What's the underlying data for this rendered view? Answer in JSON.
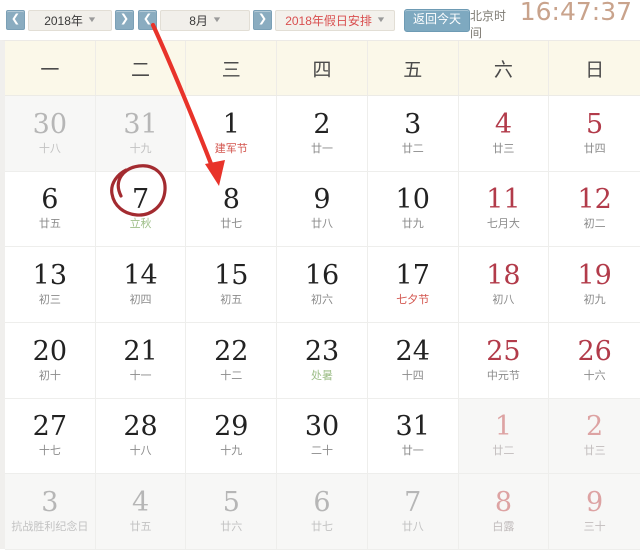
{
  "toolbar": {
    "prev_year_icon": "chevron-left-icon",
    "next_year_icon": "chevron-right-icon",
    "prev_month_icon": "chevron-left-icon",
    "next_month_icon": "chevron-right-icon",
    "year_value": "2018年",
    "month_value": "8月",
    "holiday_value": "2018年假日安排",
    "today_label": "返回今天",
    "caret_icon": "chevron-down-icon",
    "clock_label": "北京时间",
    "clock_time": "16:47:37",
    "accent_blue": "#7ea9c0",
    "holiday_red": "#d94f4f",
    "clock_color": "#c9a38c"
  },
  "calendar": {
    "weekdays": [
      "一",
      "二",
      "三",
      "四",
      "五",
      "六",
      "日"
    ],
    "header_background": "#fbf8e9",
    "weekend_color": "#b23b4a",
    "festival_color": "#d3564f",
    "solar_term_color": "#9fbf8a",
    "days": [
      {
        "num": "30",
        "sub": "十八",
        "out": true,
        "weekend": false,
        "sub_type": "lunar"
      },
      {
        "num": "31",
        "sub": "十九",
        "out": true,
        "weekend": false,
        "sub_type": "lunar"
      },
      {
        "num": "1",
        "sub": "建军节",
        "out": false,
        "weekend": false,
        "sub_type": "festival"
      },
      {
        "num": "2",
        "sub": "廿一",
        "out": false,
        "weekend": false,
        "sub_type": "lunar"
      },
      {
        "num": "3",
        "sub": "廿二",
        "out": false,
        "weekend": false,
        "sub_type": "lunar"
      },
      {
        "num": "4",
        "sub": "廿三",
        "out": false,
        "weekend": true,
        "sub_type": "lunar"
      },
      {
        "num": "5",
        "sub": "廿四",
        "out": false,
        "weekend": true,
        "sub_type": "lunar"
      },
      {
        "num": "6",
        "sub": "廿五",
        "out": false,
        "weekend": false,
        "sub_type": "lunar"
      },
      {
        "num": "7",
        "sub": "立秋",
        "out": false,
        "weekend": false,
        "sub_type": "term"
      },
      {
        "num": "8",
        "sub": "廿七",
        "out": false,
        "weekend": false,
        "sub_type": "lunar"
      },
      {
        "num": "9",
        "sub": "廿八",
        "out": false,
        "weekend": false,
        "sub_type": "lunar"
      },
      {
        "num": "10",
        "sub": "廿九",
        "out": false,
        "weekend": false,
        "sub_type": "lunar"
      },
      {
        "num": "11",
        "sub": "七月大",
        "out": false,
        "weekend": true,
        "sub_type": "lunar"
      },
      {
        "num": "12",
        "sub": "初二",
        "out": false,
        "weekend": true,
        "sub_type": "lunar"
      },
      {
        "num": "13",
        "sub": "初三",
        "out": false,
        "weekend": false,
        "sub_type": "lunar"
      },
      {
        "num": "14",
        "sub": "初四",
        "out": false,
        "weekend": false,
        "sub_type": "lunar"
      },
      {
        "num": "15",
        "sub": "初五",
        "out": false,
        "weekend": false,
        "sub_type": "lunar"
      },
      {
        "num": "16",
        "sub": "初六",
        "out": false,
        "weekend": false,
        "sub_type": "lunar"
      },
      {
        "num": "17",
        "sub": "七夕节",
        "out": false,
        "weekend": false,
        "sub_type": "festival"
      },
      {
        "num": "18",
        "sub": "初八",
        "out": false,
        "weekend": true,
        "sub_type": "lunar"
      },
      {
        "num": "19",
        "sub": "初九",
        "out": false,
        "weekend": true,
        "sub_type": "lunar"
      },
      {
        "num": "20",
        "sub": "初十",
        "out": false,
        "weekend": false,
        "sub_type": "lunar"
      },
      {
        "num": "21",
        "sub": "十一",
        "out": false,
        "weekend": false,
        "sub_type": "lunar"
      },
      {
        "num": "22",
        "sub": "十二",
        "out": false,
        "weekend": false,
        "sub_type": "lunar"
      },
      {
        "num": "23",
        "sub": "处暑",
        "out": false,
        "weekend": false,
        "sub_type": "term"
      },
      {
        "num": "24",
        "sub": "十四",
        "out": false,
        "weekend": false,
        "sub_type": "lunar"
      },
      {
        "num": "25",
        "sub": "中元节",
        "out": false,
        "weekend": true,
        "sub_type": "festival"
      },
      {
        "num": "26",
        "sub": "十六",
        "out": false,
        "weekend": true,
        "sub_type": "lunar"
      },
      {
        "num": "27",
        "sub": "十七",
        "out": false,
        "weekend": false,
        "sub_type": "lunar"
      },
      {
        "num": "28",
        "sub": "十八",
        "out": false,
        "weekend": false,
        "sub_type": "lunar"
      },
      {
        "num": "29",
        "sub": "十九",
        "out": false,
        "weekend": false,
        "sub_type": "lunar"
      },
      {
        "num": "30",
        "sub": "二十",
        "out": false,
        "weekend": false,
        "sub_type": "lunar"
      },
      {
        "num": "31",
        "sub": "廿一",
        "out": false,
        "weekend": false,
        "sub_type": "lunar"
      },
      {
        "num": "1",
        "sub": "廿二",
        "out": true,
        "weekend": true,
        "sub_type": "lunar"
      },
      {
        "num": "2",
        "sub": "廿三",
        "out": true,
        "weekend": true,
        "sub_type": "lunar"
      },
      {
        "num": "3",
        "sub": "抗战胜利纪念日",
        "out": true,
        "weekend": false,
        "sub_type": "festival-dim"
      },
      {
        "num": "4",
        "sub": "廿五",
        "out": true,
        "weekend": false,
        "sub_type": "lunar"
      },
      {
        "num": "5",
        "sub": "廿六",
        "out": true,
        "weekend": false,
        "sub_type": "lunar"
      },
      {
        "num": "6",
        "sub": "廿七",
        "out": true,
        "weekend": false,
        "sub_type": "lunar"
      },
      {
        "num": "7",
        "sub": "廿八",
        "out": true,
        "weekend": false,
        "sub_type": "lunar"
      },
      {
        "num": "8",
        "sub": "白露",
        "out": true,
        "weekend": true,
        "sub_type": "term-dim"
      },
      {
        "num": "9",
        "sub": "三十",
        "out": true,
        "weekend": true,
        "sub_type": "lunar"
      }
    ]
  },
  "annotations": {
    "circle_target_day": "7",
    "arrow_target_day": "8",
    "ink_color": "#e8332a",
    "circle_color": "#a32b30"
  }
}
